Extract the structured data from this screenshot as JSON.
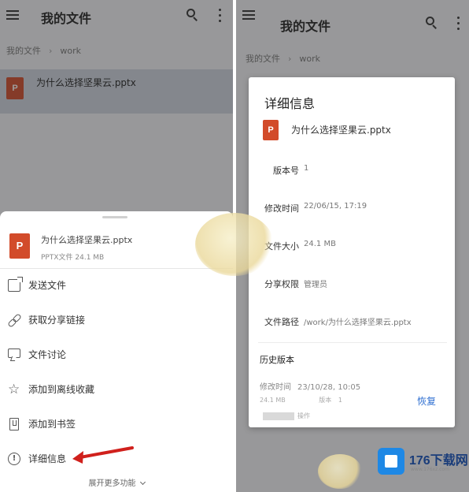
{
  "appbar": {
    "title": "我的文件"
  },
  "breadcrumb": {
    "root": "我的文件",
    "folder": "work"
  },
  "file": {
    "name": "为什么选择坚果云.pptx",
    "icon_letter": "P",
    "type_size": "PPTX文件 24.1 MB"
  },
  "sheet": {
    "actions": [
      {
        "label": "发送文件",
        "icon": "share-icon"
      },
      {
        "label": "获取分享链接",
        "icon": "link-icon"
      },
      {
        "label": "文件讨论",
        "icon": "comment-icon"
      },
      {
        "label": "添加到离线收藏",
        "icon": "star-icon"
      },
      {
        "label": "添加到书签",
        "icon": "bookmark-icon"
      },
      {
        "label": "详细信息",
        "icon": "info-icon"
      }
    ],
    "expand_label": "展开更多功能"
  },
  "details": {
    "title": "详细信息",
    "rows": [
      {
        "label": "版本号",
        "value": "1"
      },
      {
        "label": "修改时间",
        "value": "22/06/15, 17:19"
      },
      {
        "label": "文件大小",
        "value": "24.1 MB"
      },
      {
        "label": "分享权限",
        "value": "管理员"
      },
      {
        "label": "文件路径",
        "value": "/work/为什么选择坚果云.pptx"
      }
    ],
    "history_title": "历史版本",
    "history": {
      "label": "修改时间",
      "value": "23/10/28, 10:05",
      "size": "24.1 MB",
      "version_label": "版本",
      "version": "1",
      "by_label": "操作",
      "restore_label": "恢复"
    }
  },
  "watermark": {
    "brand": "176下载网",
    "url": "www.176xz.com"
  },
  "colors": {
    "ppt": "#d24b2a",
    "restore": "#2f6fd1",
    "arrow": "#d0201c",
    "logo": "#1e88e5"
  }
}
